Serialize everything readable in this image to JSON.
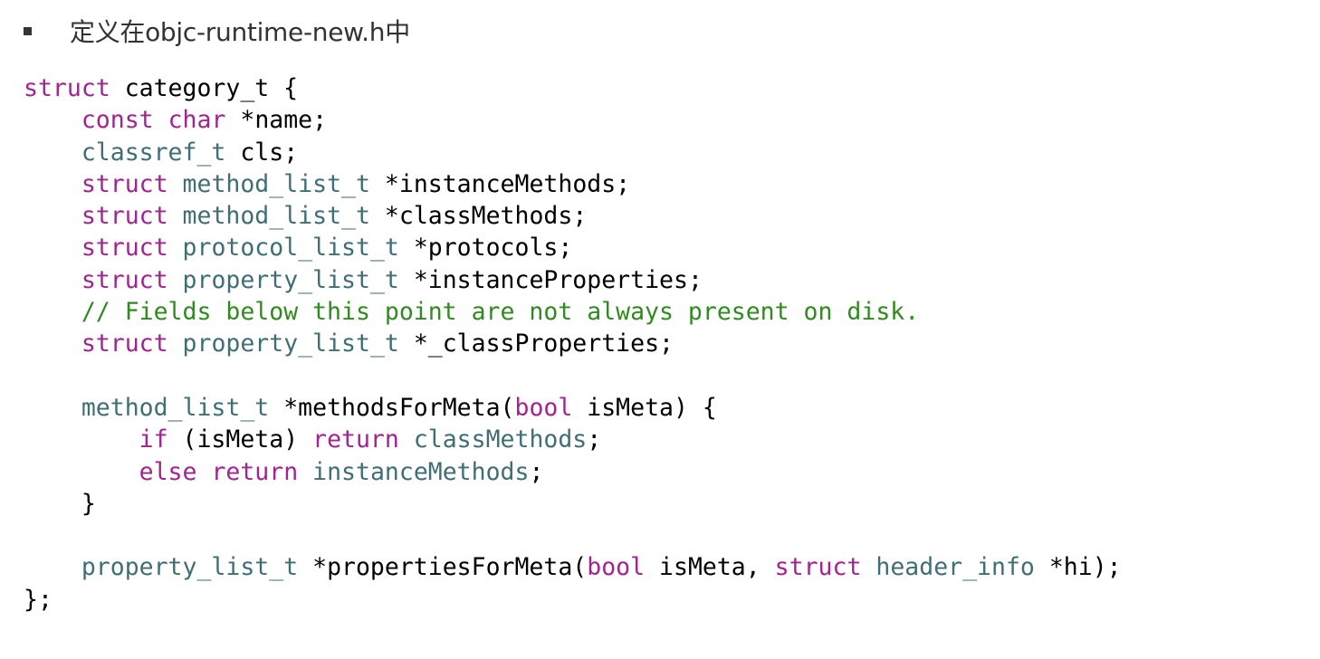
{
  "heading": {
    "bullet_icon": "square-bullet",
    "text": "定义在objc-runtime-new.h中"
  },
  "colors": {
    "keyword": "#a3238f",
    "type": "#3f6e74",
    "plain": "#000000",
    "comment": "#2f8b1f",
    "heading_text": "#333333"
  },
  "code": {
    "lines": [
      [
        {
          "t": "kw",
          "s": "struct"
        },
        {
          "t": "plain",
          "s": " category_t {"
        }
      ],
      [
        {
          "t": "plain",
          "s": "    "
        },
        {
          "t": "kw",
          "s": "const"
        },
        {
          "t": "plain",
          "s": " "
        },
        {
          "t": "kw",
          "s": "char"
        },
        {
          "t": "plain",
          "s": " *name;"
        }
      ],
      [
        {
          "t": "plain",
          "s": "    "
        },
        {
          "t": "type",
          "s": "classref_t"
        },
        {
          "t": "plain",
          "s": " cls;"
        }
      ],
      [
        {
          "t": "plain",
          "s": "    "
        },
        {
          "t": "kw",
          "s": "struct"
        },
        {
          "t": "plain",
          "s": " "
        },
        {
          "t": "type",
          "s": "method_list_t"
        },
        {
          "t": "plain",
          "s": " *instanceMethods;"
        }
      ],
      [
        {
          "t": "plain",
          "s": "    "
        },
        {
          "t": "kw",
          "s": "struct"
        },
        {
          "t": "plain",
          "s": " "
        },
        {
          "t": "type",
          "s": "method_list_t"
        },
        {
          "t": "plain",
          "s": " *classMethods;"
        }
      ],
      [
        {
          "t": "plain",
          "s": "    "
        },
        {
          "t": "kw",
          "s": "struct"
        },
        {
          "t": "plain",
          "s": " "
        },
        {
          "t": "type",
          "s": "protocol_list_t"
        },
        {
          "t": "plain",
          "s": " *protocols;"
        }
      ],
      [
        {
          "t": "plain",
          "s": "    "
        },
        {
          "t": "kw",
          "s": "struct"
        },
        {
          "t": "plain",
          "s": " "
        },
        {
          "t": "type",
          "s": "property_list_t"
        },
        {
          "t": "plain",
          "s": " *instanceProperties;"
        }
      ],
      [
        {
          "t": "plain",
          "s": "    "
        },
        {
          "t": "comment",
          "s": "// Fields below this point are not always present on disk."
        }
      ],
      [
        {
          "t": "plain",
          "s": "    "
        },
        {
          "t": "kw",
          "s": "struct"
        },
        {
          "t": "plain",
          "s": " "
        },
        {
          "t": "type",
          "s": "property_list_t"
        },
        {
          "t": "plain",
          "s": " *_classProperties;"
        }
      ],
      [],
      [
        {
          "t": "plain",
          "s": "    "
        },
        {
          "t": "type",
          "s": "method_list_t"
        },
        {
          "t": "plain",
          "s": " *methodsForMeta("
        },
        {
          "t": "kw",
          "s": "bool"
        },
        {
          "t": "plain",
          "s": " isMeta) {"
        }
      ],
      [
        {
          "t": "plain",
          "s": "        "
        },
        {
          "t": "kw",
          "s": "if"
        },
        {
          "t": "plain",
          "s": " (isMeta) "
        },
        {
          "t": "kw",
          "s": "return"
        },
        {
          "t": "plain",
          "s": " "
        },
        {
          "t": "type",
          "s": "classMethods"
        },
        {
          "t": "plain",
          "s": ";"
        }
      ],
      [
        {
          "t": "plain",
          "s": "        "
        },
        {
          "t": "kw",
          "s": "else"
        },
        {
          "t": "plain",
          "s": " "
        },
        {
          "t": "kw",
          "s": "return"
        },
        {
          "t": "plain",
          "s": " "
        },
        {
          "t": "type",
          "s": "instanceMethods"
        },
        {
          "t": "plain",
          "s": ";"
        }
      ],
      [
        {
          "t": "plain",
          "s": "    }"
        }
      ],
      [],
      [
        {
          "t": "plain",
          "s": "    "
        },
        {
          "t": "type",
          "s": "property_list_t"
        },
        {
          "t": "plain",
          "s": " *propertiesForMeta("
        },
        {
          "t": "kw",
          "s": "bool"
        },
        {
          "t": "plain",
          "s": " isMeta, "
        },
        {
          "t": "kw",
          "s": "struct"
        },
        {
          "t": "plain",
          "s": " "
        },
        {
          "t": "type",
          "s": "header_info"
        },
        {
          "t": "plain",
          "s": " *hi);"
        }
      ],
      [
        {
          "t": "plain",
          "s": "};"
        }
      ]
    ]
  }
}
